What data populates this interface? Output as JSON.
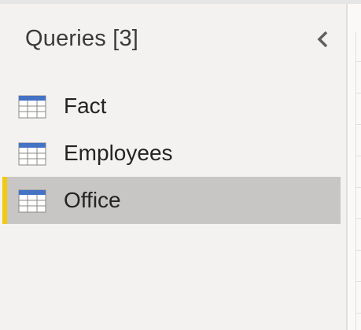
{
  "queries_panel": {
    "title": "Queries [3]",
    "collapse_icon": "chevron-left-icon",
    "items": [
      {
        "label": "Fact",
        "icon": "table-icon",
        "selected": false
      },
      {
        "label": "Employees",
        "icon": "table-icon",
        "selected": false
      },
      {
        "label": "Office",
        "icon": "table-icon",
        "selected": true
      }
    ]
  },
  "colors": {
    "panel_bg": "#f3f2f1",
    "selected_bg": "#c8c6c4",
    "selected_accent": "#f2c811",
    "table_icon_header": "#4472c4"
  }
}
